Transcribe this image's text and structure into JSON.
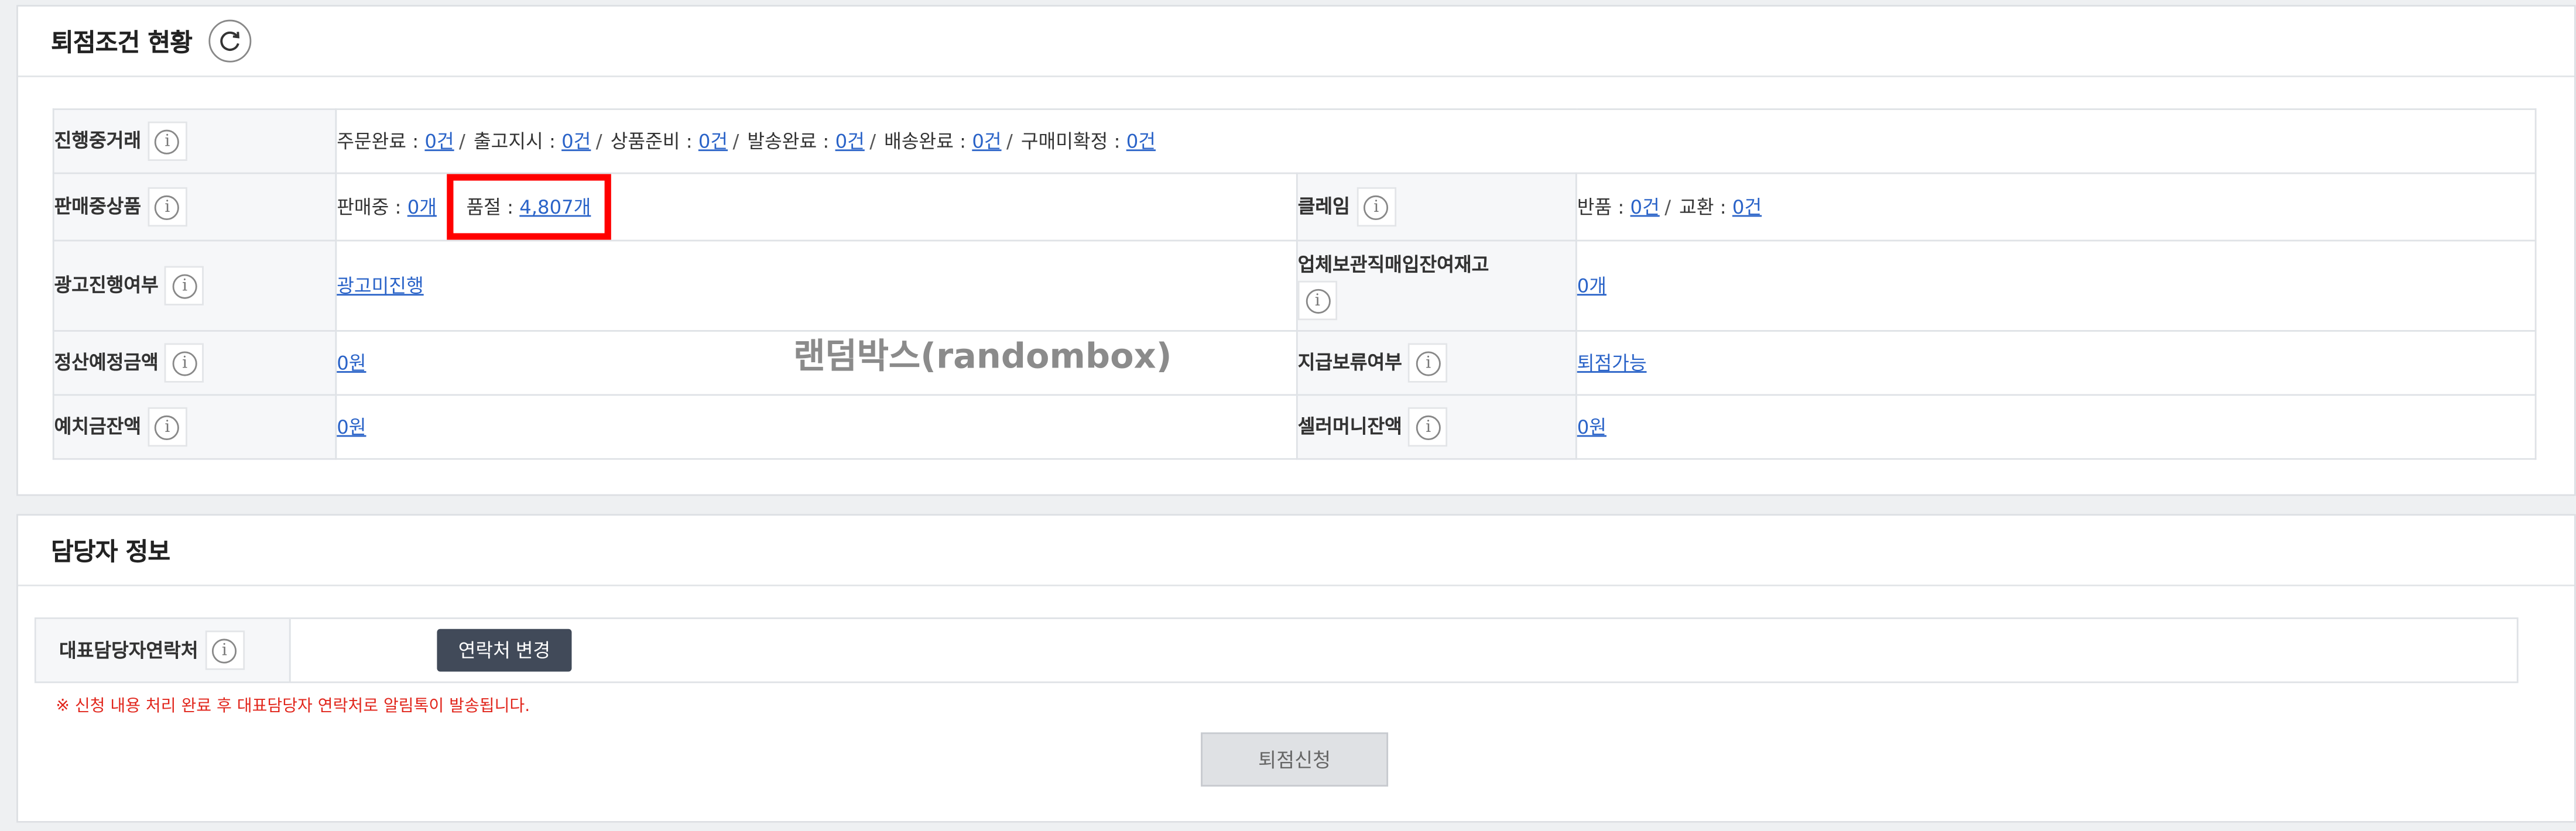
{
  "section1": {
    "title": "퇴점조건 현황",
    "rows": {
      "progress_label": "진행중거래",
      "progress_items": [
        {
          "label": "주문완료 : ",
          "value": "0건"
        },
        {
          "label": "출고지시 : ",
          "value": "0건"
        },
        {
          "label": "상품준비 : ",
          "value": "0건"
        },
        {
          "label": "발송완료 : ",
          "value": "0건"
        },
        {
          "label": "배송완료 : ",
          "value": "0건"
        },
        {
          "label": "구매미확정 : ",
          "value": "0건"
        }
      ],
      "selling_label": "판매중상품",
      "selling_on_label": "판매중 : ",
      "selling_on_value": "0개",
      "soldout_label": "품절 : ",
      "soldout_value": "4,807개",
      "claim_label": "클레임",
      "claim_return_label": "반품 : ",
      "claim_return_value": "0건",
      "claim_exchange_label": "교환 : ",
      "claim_exchange_value": "0건",
      "ad_label": "광고진행여부",
      "ad_value": "광고미진행",
      "stock_label": "업체보관직매입잔여재고",
      "stock_value": "0개",
      "settle_label": "정산예정금액",
      "settle_value": "0원",
      "hold_label": "지급보류여부",
      "hold_value": "퇴점가능",
      "deposit_label": "예치금잔액",
      "deposit_value": "0원",
      "sellermoney_label": "셀러머니잔액",
      "sellermoney_value": "0원"
    },
    "separator": "/",
    "watermark": "랜덤박스(randombox)"
  },
  "section2": {
    "title": "담당자 정보",
    "contact_label": "대표담당자연락처",
    "change_button": "연락처 변경",
    "notice": "※ 신청 내용 처리 완료 후 대표담당자 연락처로 알림톡이 발송됩니다.",
    "apply_button": "퇴점신청"
  },
  "info_glyph": "i",
  "colors": {
    "link": "#2a63c8",
    "highlight": "#ff0000",
    "notice": "#e1261c",
    "button_dark": "#414a59"
  }
}
